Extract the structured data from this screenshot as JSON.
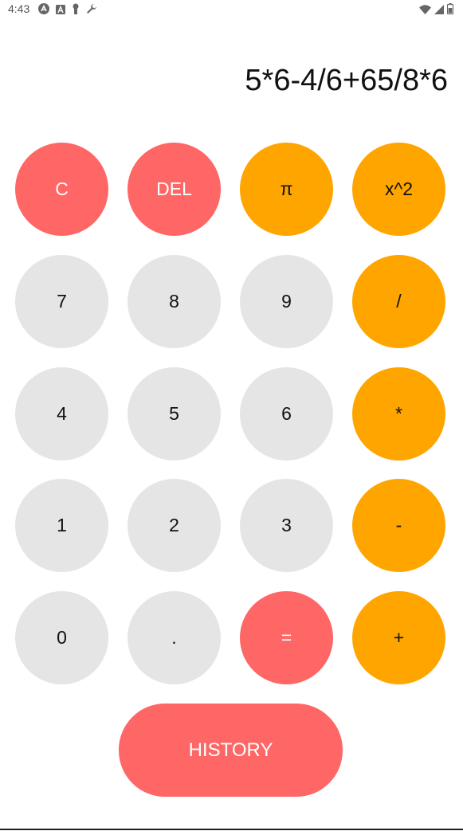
{
  "status_bar": {
    "time": "4:43",
    "left_icons": [
      "circle-a-icon",
      "a-box-icon",
      "keyhole-icon",
      "wrench-icon"
    ],
    "right_icons": [
      "wifi-icon",
      "signal-icon",
      "battery-icon"
    ]
  },
  "display": {
    "expression": "5*6-4/6+65/8*6"
  },
  "keys": {
    "clear": "C",
    "delete": "DEL",
    "pi": "π",
    "square": "x^2",
    "seven": "7",
    "eight": "8",
    "nine": "9",
    "divide": "/",
    "four": "4",
    "five": "5",
    "six": "6",
    "multiply": "*",
    "one": "1",
    "two": "2",
    "three": "3",
    "minus": "-",
    "zero": "0",
    "dot": ".",
    "equals": "=",
    "plus": "+"
  },
  "history_label": "HISTORY",
  "colors": {
    "number_key": "#e5e5e5",
    "operator_key": "#ffa500",
    "action_key": "#ff6666"
  }
}
